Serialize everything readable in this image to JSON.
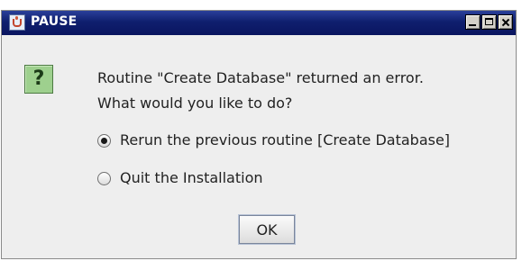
{
  "window": {
    "title": "PAUSE",
    "icon": "java-cup-icon",
    "controls": [
      "minimize-icon",
      "maximize-icon",
      "close-icon"
    ]
  },
  "dialog": {
    "icon": "question-icon",
    "icon_glyph": "?",
    "message_line1": "Routine \"Create Database\" returned an error.",
    "message_line2": "What would you like to do?",
    "options": [
      {
        "label": "Rerun the previous routine [Create Database]",
        "selected": true
      },
      {
        "label": "Quit the Installation",
        "selected": false
      }
    ],
    "ok_label": "OK"
  },
  "colors": {
    "titlebar": "#0f1f6e",
    "dialog_bg": "#eeeeee",
    "question_icon_bg": "#9ed08e"
  }
}
